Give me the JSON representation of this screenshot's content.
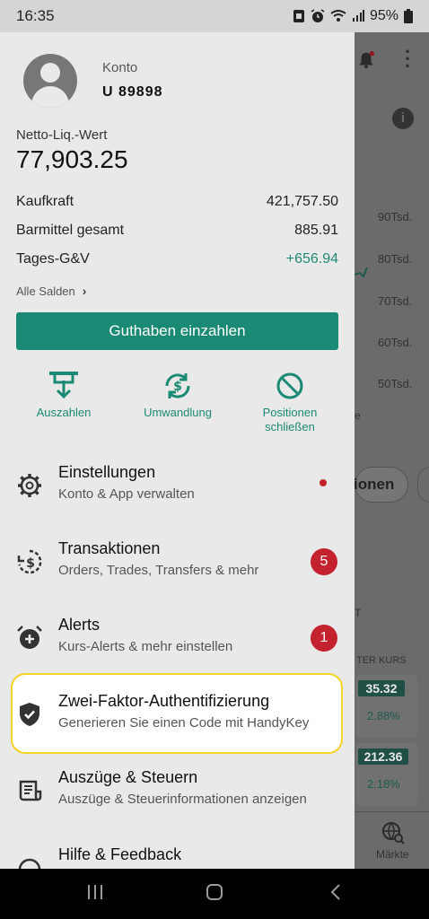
{
  "status_bar": {
    "time": "16:35",
    "battery": "95%",
    "icons": [
      "mute-icon",
      "alarm-icon",
      "wifi-icon",
      "signal-icon",
      "battery-icon"
    ]
  },
  "account": {
    "label": "Konto",
    "id": "U 89898"
  },
  "netliq": {
    "label": "Netto-Liq.-Wert",
    "value": "77,903.25"
  },
  "balances": [
    {
      "label": "Kaufkraft",
      "value": "421,757.50",
      "positive": false
    },
    {
      "label": "Barmittel gesamt",
      "value": "885.91",
      "positive": false
    },
    {
      "label": "Tages-G&V",
      "value": "+656.94",
      "positive": true
    }
  ],
  "all_balances_link": "Alle Salden",
  "deposit_button": "Guthaben einzahlen",
  "quick_actions": [
    {
      "label": "Auszahlen",
      "icon": "withdraw-icon"
    },
    {
      "label": "Umwandlung",
      "icon": "currency-exchange-icon"
    },
    {
      "label": "Positionen schließen",
      "line1": "Positionen",
      "line2": "schließen",
      "icon": "block-icon"
    }
  ],
  "menu": [
    {
      "title": "Einstellungen",
      "subtitle": "Konto & App verwalten",
      "icon": "gear-icon",
      "indicator": "dot"
    },
    {
      "title": "Transaktionen",
      "subtitle": "Orders, Trades, Transfers & mehr",
      "icon": "transactions-icon",
      "badge": "5"
    },
    {
      "title": "Alerts",
      "subtitle": "Kurs-Alerts & mehr einstellen",
      "icon": "alarm-add-icon",
      "badge": "1"
    },
    {
      "title": "Zwei-Faktor-Authentifizierung",
      "subtitle": "Generieren Sie einen Code mit HandyKey",
      "icon": "shield-check-icon"
    },
    {
      "title": "Auszüge & Steuern",
      "subtitle": "Auszüge & Steuerinformationen anzeigen",
      "icon": "statement-icon"
    },
    {
      "title": "Hilfe & Feedback",
      "subtitle": "",
      "icon": "help-icon"
    }
  ],
  "background": {
    "chart_ticks": [
      "90Tsd.",
      "80Tsd.",
      "70Tsd.",
      "60Tsd.",
      "50Tsd."
    ],
    "chip_text": "ionen",
    "t_text": "T",
    "e_text": "e",
    "kurs_label": "TER KURS",
    "cards": [
      {
        "price": "35.32",
        "pct": "2.88%"
      },
      {
        "price": "212.36",
        "pct": "2.18%"
      }
    ],
    "nav_label": "Märkte",
    "colors": {
      "accent": "#1a8a74",
      "badge": "#c3222e",
      "highlight": "#f5d42a"
    }
  }
}
